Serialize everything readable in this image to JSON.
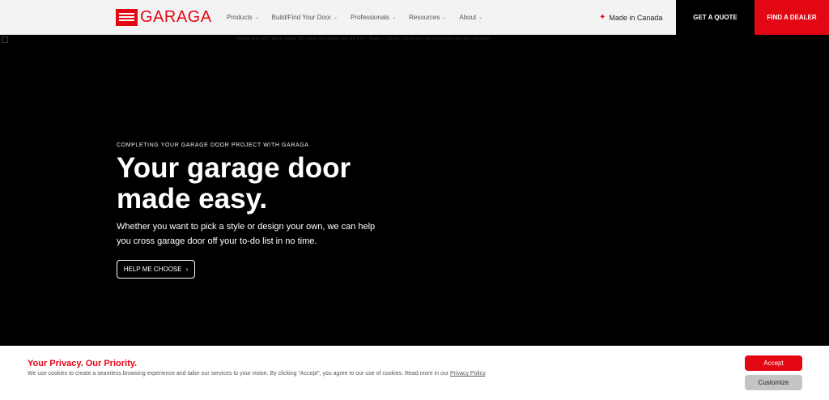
{
  "header": {
    "logo_text": "GARAGA",
    "nav": [
      {
        "label": "Products"
      },
      {
        "label": "Build/Find Your Door"
      },
      {
        "label": "Professionals"
      },
      {
        "label": "Resources"
      },
      {
        "label": "About"
      }
    ],
    "made_in": "Made in Canada",
    "quote_label": "GET A QUOTE",
    "dealer_label": "FIND A DEALER"
  },
  "hero": {
    "image_alt": "Garage door with 2 Black Garage 350 (Steel) Styl garage door (16' x 8') – Made in Canada. Coordinated with a Vug entry door from Novatech",
    "eyebrow": "COMPLETING YOUR GARAGE DOOR PROJECT WITH GARAGA",
    "headline": "Your garage door made easy.",
    "subtext": "Whether you want to pick a style or design your own, we can help you cross garage door off your to-do list in no time.",
    "cta_label": "HELP ME CHOOSE"
  },
  "cookie": {
    "title": "Your Privacy. Our Priority.",
    "text": "We use cookies to create a seamless browsing experience and tailor our services to your vision. By clicking “Accept”, you agree to our use of cookies. Read more in our ",
    "link": "Privacy Policy",
    "accept_label": "Accept",
    "customize_label": "Customize"
  },
  "colors": {
    "brand_red": "#e30613",
    "header_bg": "#f3f3f3",
    "hero_bg": "#000000"
  }
}
